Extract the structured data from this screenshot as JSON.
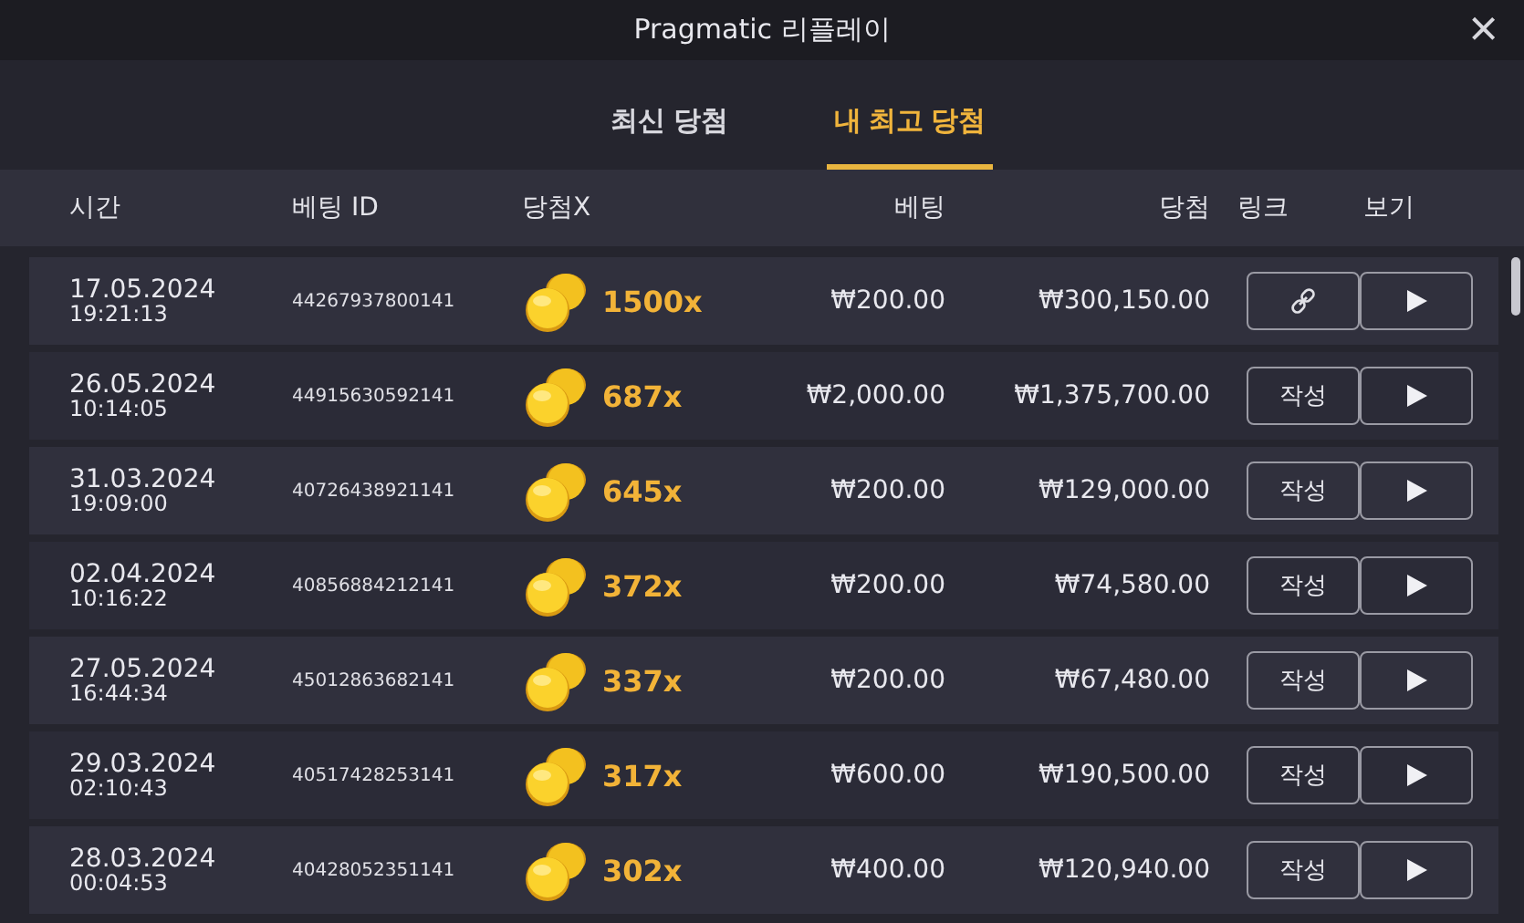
{
  "window": {
    "title": "Pragmatic 리플레이",
    "close": "×"
  },
  "tabs": [
    {
      "label": "최신 당첨",
      "selected": false
    },
    {
      "label": "내 최고 당첨",
      "selected": true
    }
  ],
  "table": {
    "columns": [
      "시간",
      "베팅 ID",
      "당첨X",
      "베팅",
      "당첨",
      "링크",
      "보기"
    ],
    "rows": [
      {
        "date": "17.05.2024",
        "time": "19:21:13",
        "id": "44267937800141",
        "multiplier": "1500x",
        "bet": "₩200.00",
        "win": "₩300,150.00",
        "link": {
          "kind": "icon"
        }
      },
      {
        "date": "26.05.2024",
        "time": "10:14:05",
        "id": "44915630592141",
        "multiplier": "687x",
        "bet": "₩2,000.00",
        "win": "₩1,375,700.00",
        "link": {
          "kind": "text",
          "label": "작성"
        }
      },
      {
        "date": "31.03.2024",
        "time": "19:09:00",
        "id": "40726438921141",
        "multiplier": "645x",
        "bet": "₩200.00",
        "win": "₩129,000.00",
        "link": {
          "kind": "text",
          "label": "작성"
        }
      },
      {
        "date": "02.04.2024",
        "time": "10:16:22",
        "id": "40856884212141",
        "multiplier": "372x",
        "bet": "₩200.00",
        "win": "₩74,580.00",
        "link": {
          "kind": "text",
          "label": "작성"
        }
      },
      {
        "date": "27.05.2024",
        "time": "16:44:34",
        "id": "45012863682141",
        "multiplier": "337x",
        "bet": "₩200.00",
        "win": "₩67,480.00",
        "link": {
          "kind": "text",
          "label": "작성"
        }
      },
      {
        "date": "29.03.2024",
        "time": "02:10:43",
        "id": "40517428253141",
        "multiplier": "317x",
        "bet": "₩600.00",
        "win": "₩190,500.00",
        "link": {
          "kind": "text",
          "label": "작성"
        }
      },
      {
        "date": "28.03.2024",
        "time": "00:04:53",
        "id": "40428052351141",
        "multiplier": "302x",
        "bet": "₩400.00",
        "win": "₩120,940.00",
        "link": {
          "kind": "text",
          "label": "작성"
        }
      }
    ]
  }
}
